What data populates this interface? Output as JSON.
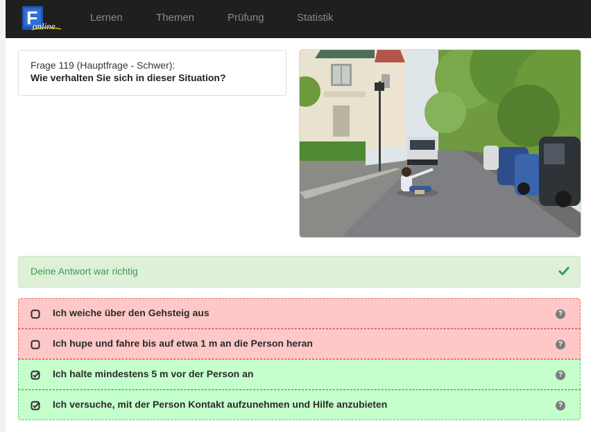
{
  "navbar": {
    "logo_letter": "F",
    "logo_word": "online",
    "items": [
      "Lernen",
      "Themen",
      "Prüfung",
      "Statistik"
    ]
  },
  "question": {
    "meta": "Frage 119 (Hauptfrage - Schwer):",
    "text": "Wie verhalten Sie sich in dieser Situation?"
  },
  "result": {
    "text": "Deine Antwort war richtig",
    "icon": "check-icon"
  },
  "answers": [
    {
      "label": "Ich weiche über den Gehsteig aus",
      "checked": false,
      "status": "wrong"
    },
    {
      "label": "Ich hupe und fahre bis auf etwa 1 m an die Person heran",
      "checked": false,
      "status": "wrong"
    },
    {
      "label": "Ich halte mindestens 5 m vor der Person an",
      "checked": true,
      "status": "right"
    },
    {
      "label": "Ich versuche, mit der Person Kontakt aufzunehmen und Hilfe anzubieten",
      "checked": true,
      "status": "right"
    }
  ],
  "help_icon_glyph": "?",
  "colors": {
    "navbar_bg": "#1f1f1f",
    "logo_blue": "#1c58b8",
    "success_bg": "#dff0d8",
    "success_text": "#3c9a4c",
    "wrong_bg": "#ffc8c8",
    "right_bg": "#c4ffcc"
  }
}
